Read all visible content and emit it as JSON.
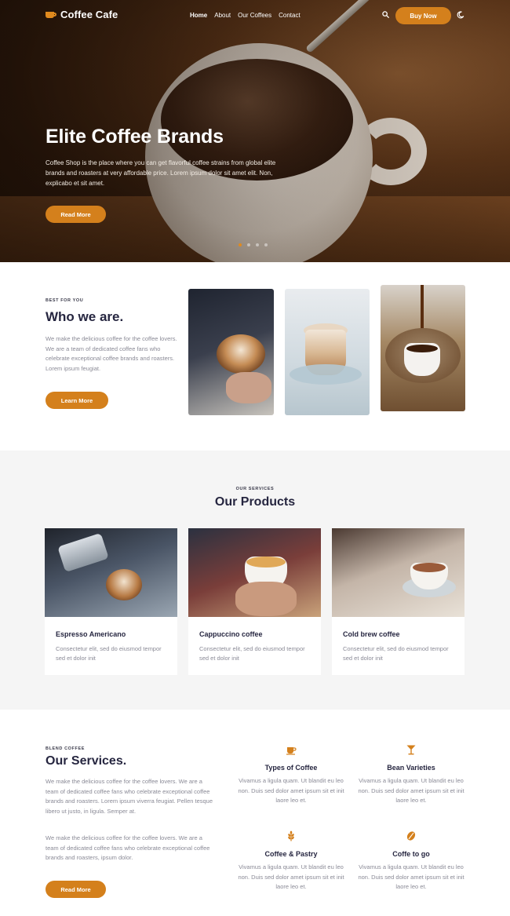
{
  "brand": {
    "name": "Coffee Cafe",
    "accent": "#d4801c"
  },
  "nav": {
    "items": [
      {
        "label": "Home"
      },
      {
        "label": "About"
      },
      {
        "label": "Our Coffees"
      },
      {
        "label": "Contact"
      }
    ],
    "buy_label": "Buy Now"
  },
  "hero": {
    "title": "Elite Coffee Brands",
    "description": "Coffee Shop is the place where you can get flavorful coffee strains from global elite brands and roasters at very affordable price. Lorem ipsum dolor sit amet elit. Non, explicabo et sit amet.",
    "button": "Read More",
    "slides": 4,
    "active_slide": 1
  },
  "about": {
    "eyebrow": "BEST FOR YOU",
    "title": "Who we are.",
    "description": "We make the delicious coffee for the coffee lovers. We are a team of dedicated coffee fans who celebrate exceptional coffee brands and roasters. Lorem ipsum feugiat.",
    "button": "Learn More"
  },
  "products": {
    "eyebrow": "OUR SERVICES",
    "title": "Our Products",
    "items": [
      {
        "title": "Espresso Americano",
        "text": "Consectetur elit, sed do eiusmod tempor sed et dolor init"
      },
      {
        "title": "Cappuccino coffee",
        "text": "Consectetur elit, sed do eiusmod tempor sed et dolor init"
      },
      {
        "title": "Cold brew coffee",
        "text": "Consectetur elit, sed do eiusmod tempor sed et dolor init"
      }
    ]
  },
  "services": {
    "eyebrow": "BLEND COFFEE",
    "title": "Our Services.",
    "paragraph1": "We make the delicious coffee for the coffee lovers. We are a team of dedicated coffee fans who celebrate exceptional coffee brands and roasters. Lorem ipsum viverra feugiat. Pellen tesque libero ut justo, in ligula. Semper at.",
    "paragraph2": "We make the delicious coffee for the coffee lovers. We are a team of dedicated coffee fans who celebrate exceptional coffee brands and roasters, ipsum dolor.",
    "button": "Read More",
    "features": [
      {
        "icon": "coffee-cup-icon",
        "title": "Types of Coffee",
        "text": "Vivamus a ligula quam. Ut blandit eu leo non. Duis sed dolor amet ipsum sit et init laore leo et."
      },
      {
        "icon": "cocktail-glass-icon",
        "title": "Bean Varieties",
        "text": "Vivamus a ligula quam. Ut blandit eu leo non. Duis sed dolor amet ipsum sit et init laore leo et."
      },
      {
        "icon": "wheat-icon",
        "title": "Coffee & Pastry",
        "text": "Vivamus a ligula quam. Ut blandit eu leo non. Duis sed dolor amet ipsum sit et init laore leo et."
      },
      {
        "icon": "coffee-bean-icon",
        "title": "Coffe to go",
        "text": "Vivamus a ligula quam. Ut blandit eu leo non. Duis sed dolor amet ipsum sit et init laore leo et."
      }
    ]
  }
}
